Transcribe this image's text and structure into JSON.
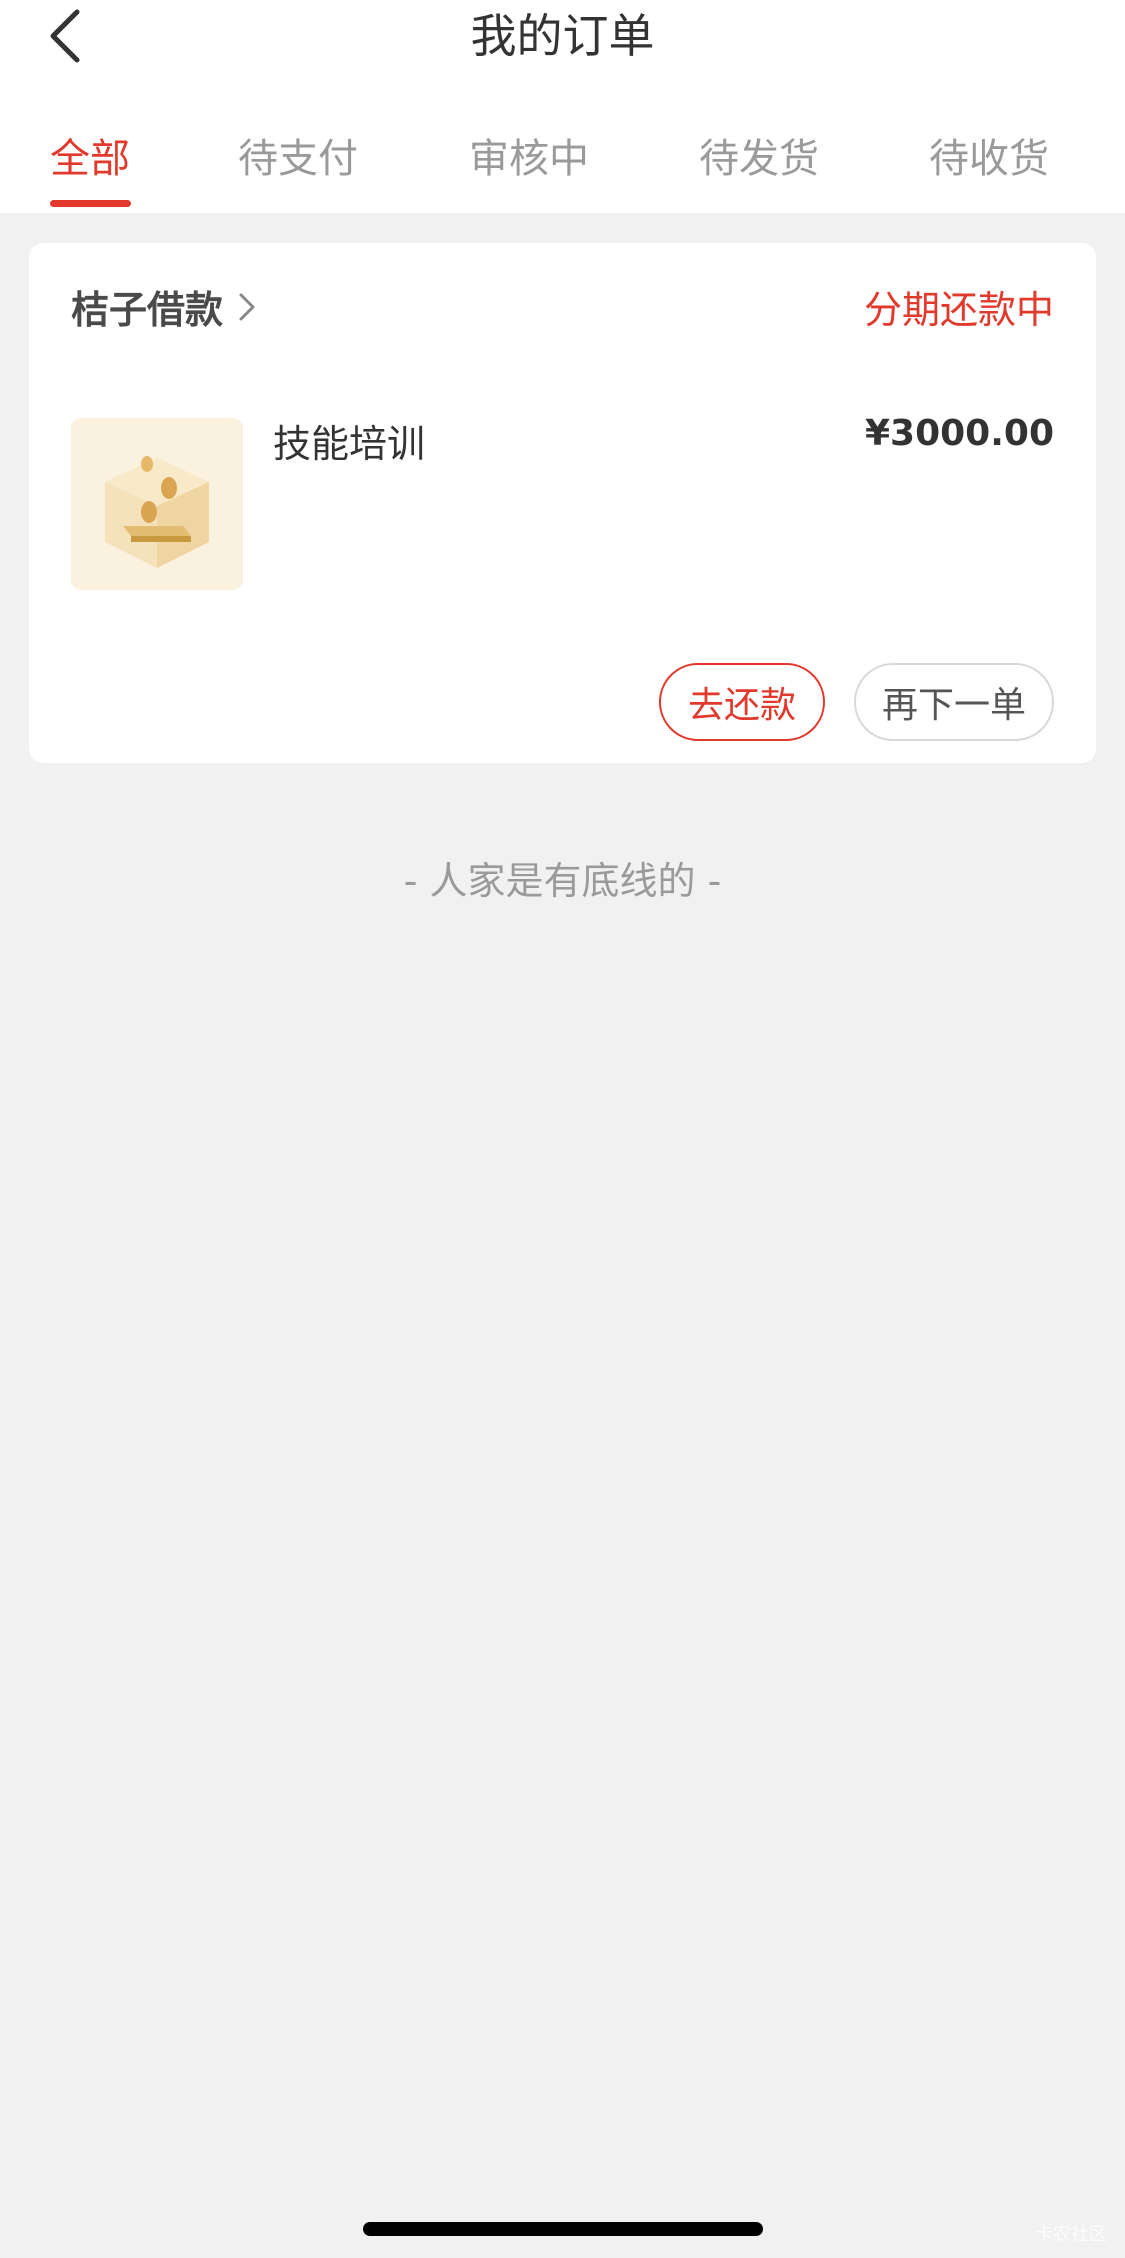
{
  "header": {
    "title": "我的订单",
    "back_icon": "chevron-left-icon"
  },
  "tabs": [
    {
      "label": "全部",
      "active": true
    },
    {
      "label": "待支付",
      "active": false
    },
    {
      "label": "审核中",
      "active": false
    },
    {
      "label": "待发货",
      "active": false
    },
    {
      "label": "待收货",
      "active": false
    }
  ],
  "order": {
    "shop_name": "桔子借款",
    "status": "分期还款中",
    "product_name": "技能培训",
    "price": "¥3000.00",
    "repay_button": "去还款",
    "reorder_button": "再下一单"
  },
  "footer_note": "- 人家是有底线的 -",
  "watermark": "卡农社区",
  "colors": {
    "accent": "#e2392d",
    "background": "#f1f1f1"
  }
}
